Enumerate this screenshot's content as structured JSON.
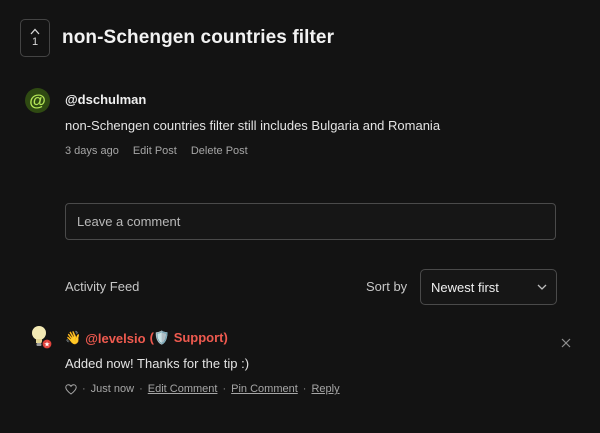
{
  "post": {
    "vote_count": "1",
    "title": "non-Schengen countries filter",
    "author": "@dschulman",
    "body": "non-Schengen countries filter still includes Bulgaria and Romania",
    "time": "3 days ago",
    "edit_label": "Edit Post",
    "delete_label": "Delete Post",
    "avatar_symbol": "@"
  },
  "comment_box": {
    "placeholder": "Leave a comment"
  },
  "feed": {
    "title": "Activity Feed",
    "sort_label": "Sort by",
    "sort_value": "Newest first"
  },
  "comment": {
    "author_emoji": "👋",
    "author": "@levelsio",
    "role": "(🛡️ Support)",
    "body": "Added now! Thanks for the tip :)",
    "time": "Just now",
    "edit_label": "Edit Comment",
    "pin_label": "Pin Comment",
    "reply_label": "Reply",
    "separator": "·"
  },
  "colors": {
    "background": "#131313",
    "support_name": "#ef5a4f",
    "avatar_green": "#b4e657"
  }
}
